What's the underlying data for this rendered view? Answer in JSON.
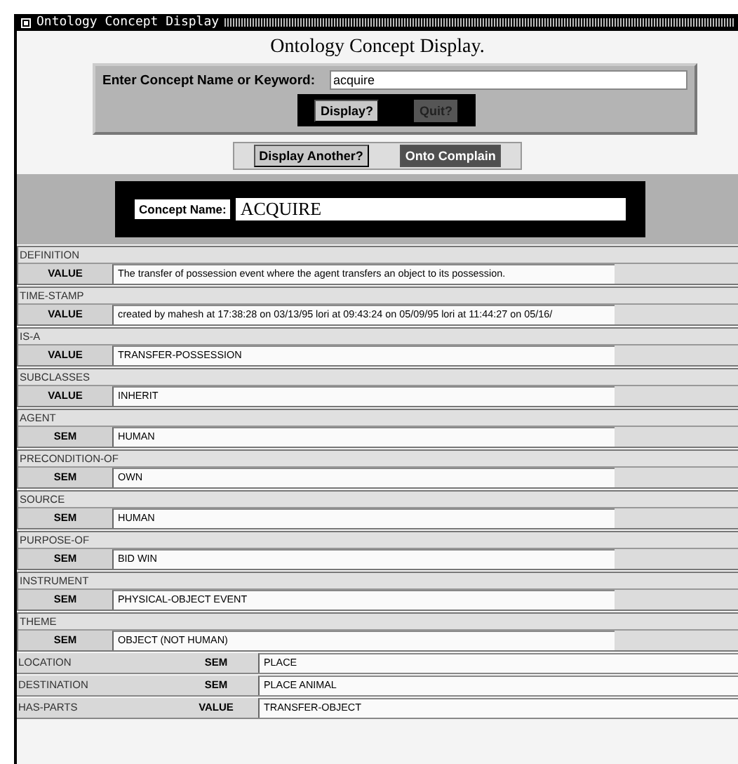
{
  "window": {
    "title": "Ontology Concept Display"
  },
  "heading": "Ontology Concept Display.",
  "search": {
    "label": "Enter Concept Name or Keyword:",
    "value": "acquire",
    "buttons": [
      {
        "label": "Display?",
        "kind": "light"
      },
      {
        "label": "Quit?",
        "kind": "dim"
      }
    ]
  },
  "nav_buttons": [
    {
      "label": "Display Another?",
      "kind": "light"
    },
    {
      "label": "Onto Complain",
      "kind": "dark"
    }
  ],
  "concept": {
    "label": "Concept Name:",
    "value": "ACQUIRE"
  },
  "slots": [
    {
      "kind": "stacked",
      "name": "DEFINITION",
      "facet": "VALUE",
      "value": "The transfer of possession event where the agent transfers an object to its possession."
    },
    {
      "kind": "stacked",
      "name": "TIME-STAMP",
      "facet": "VALUE",
      "value": "created by mahesh at 17:38:28 on 03/13/95 lori at 09:43:24 on 05/09/95   lori at 11:44:27 on 05/16/"
    },
    {
      "kind": "stacked",
      "name": "IS-A",
      "facet": "VALUE",
      "value": "TRANSFER-POSSESSION"
    },
    {
      "kind": "stacked",
      "name": "SUBCLASSES",
      "facet": "VALUE",
      "value": "INHERIT"
    },
    {
      "kind": "stacked",
      "name": "AGENT",
      "facet": "SEM",
      "value": "HUMAN"
    },
    {
      "kind": "stacked",
      "name": "PRECONDITION-OF",
      "facet": "SEM",
      "value": "OWN"
    },
    {
      "kind": "stacked",
      "name": "SOURCE",
      "facet": "SEM",
      "value": "HUMAN"
    },
    {
      "kind": "stacked",
      "name": "PURPOSE-OF",
      "facet": "SEM",
      "value": "BID WIN"
    },
    {
      "kind": "stacked",
      "name": "INSTRUMENT",
      "facet": "SEM",
      "value": "PHYSICAL-OBJECT EVENT"
    },
    {
      "kind": "stacked",
      "name": "THEME",
      "facet": "SEM",
      "value": "OBJECT (NOT HUMAN)"
    },
    {
      "kind": "inline",
      "name": "LOCATION",
      "facet": "SEM",
      "value": "PLACE"
    },
    {
      "kind": "inline",
      "name": "DESTINATION",
      "facet": "SEM",
      "value": "PLACE ANIMAL"
    },
    {
      "kind": "inline",
      "name": "HAS-PARTS",
      "facet": "VALUE",
      "value": "TRANSFER-OBJECT"
    }
  ]
}
